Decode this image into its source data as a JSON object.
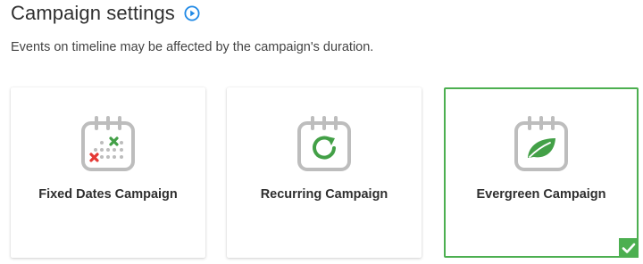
{
  "header": {
    "title": "Campaign settings",
    "subtitle": "Events on timeline may be affected by the campaign's duration."
  },
  "cards": [
    {
      "label": "Fixed Dates Campaign",
      "icon": "calendar-fixed-dates-icon",
      "selected": false
    },
    {
      "label": "Recurring Campaign",
      "icon": "calendar-recurring-icon",
      "selected": false
    },
    {
      "label": "Evergreen Campaign",
      "icon": "calendar-leaf-icon",
      "selected": true
    }
  ],
  "colors": {
    "accent_blue": "#1e88e5",
    "selected_green": "#4caf50",
    "icon_gray": "#bdbdbd",
    "mark_red": "#e53935"
  }
}
